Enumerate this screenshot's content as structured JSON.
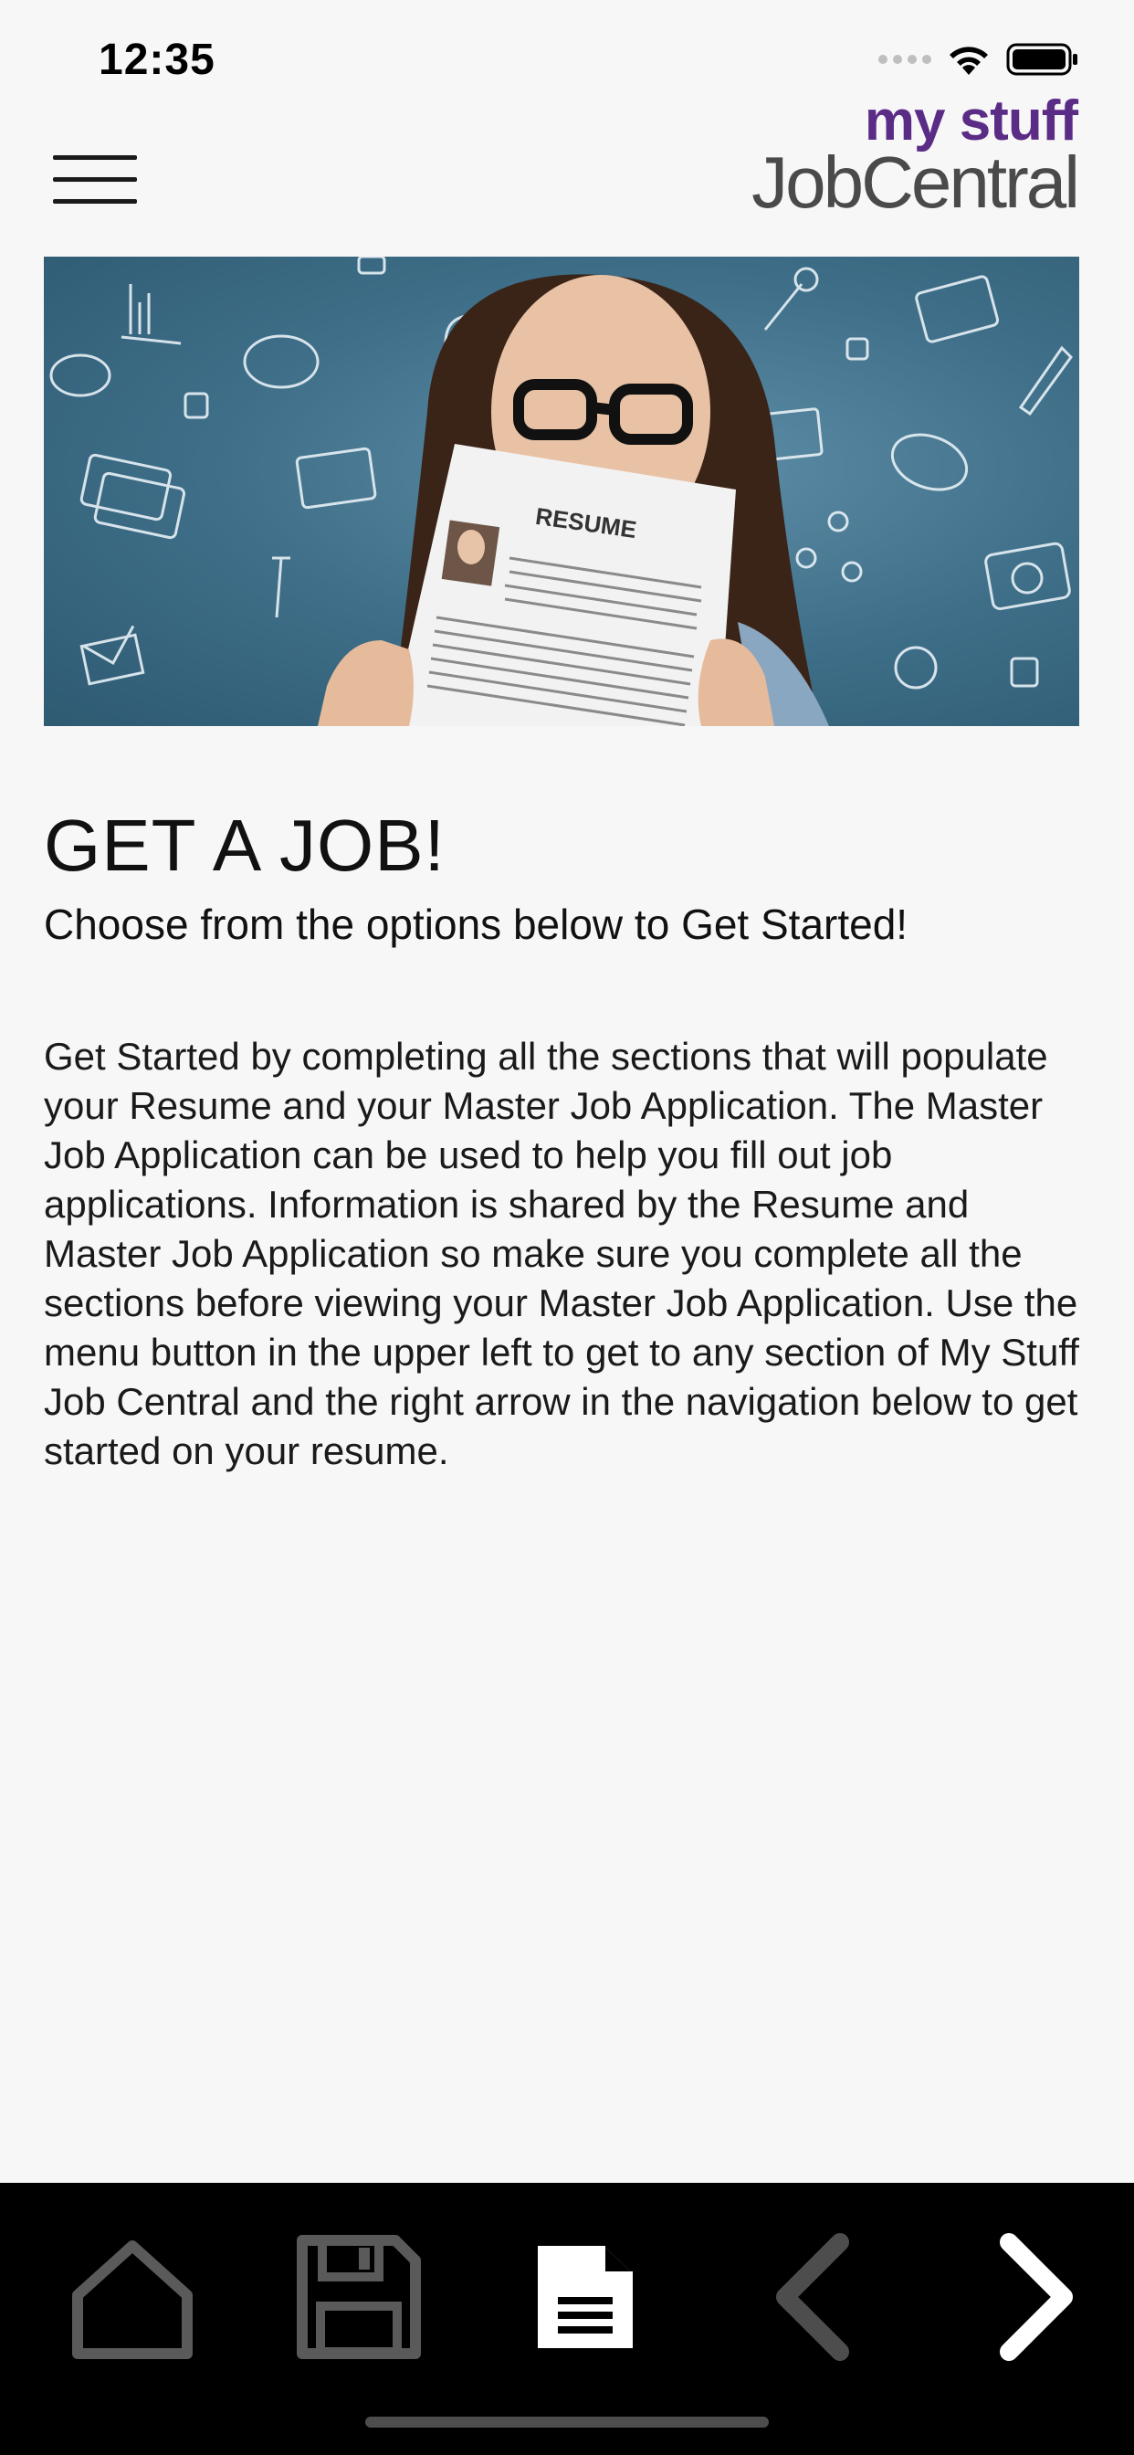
{
  "status_bar": {
    "time": "12:35",
    "icons": [
      "signal-dots-icon",
      "wifi-icon",
      "battery-icon"
    ]
  },
  "header": {
    "menu_icon": "hamburger-menu-icon",
    "logo_top": "my stuff",
    "logo_bottom": "JobCentral"
  },
  "hero": {
    "resume_label": "RESUME"
  },
  "content": {
    "title": "GET A JOB!",
    "subtitle": "Choose from the options below to Get Started!",
    "body": "Get Started by completing all the sections that will populate your Resume and your Master Job Application. The Master Job Application can be used to help you fill out job applications. Information is shared by the Resume and Master Job Application so make sure you complete all the sections before viewing your Master Job Application. Use the menu button in the upper left to get to any section of My Stuff Job Central and the right arrow in the navigation below to get started on your resume."
  },
  "bottom_nav": {
    "items": [
      {
        "icon": "home-icon",
        "state": "inactive"
      },
      {
        "icon": "save-icon",
        "state": "inactive"
      },
      {
        "icon": "document-icon",
        "state": "active"
      },
      {
        "icon": "chevron-left-icon",
        "state": "disabled"
      },
      {
        "icon": "chevron-right-icon",
        "state": "active"
      }
    ]
  },
  "colors": {
    "background": "#f7f7f7",
    "brand_purple": "#5b2c86",
    "logo_gray": "#4a4a4a",
    "nav_background": "#000000",
    "nav_active": "#ffffff",
    "nav_inactive": "#555555"
  }
}
